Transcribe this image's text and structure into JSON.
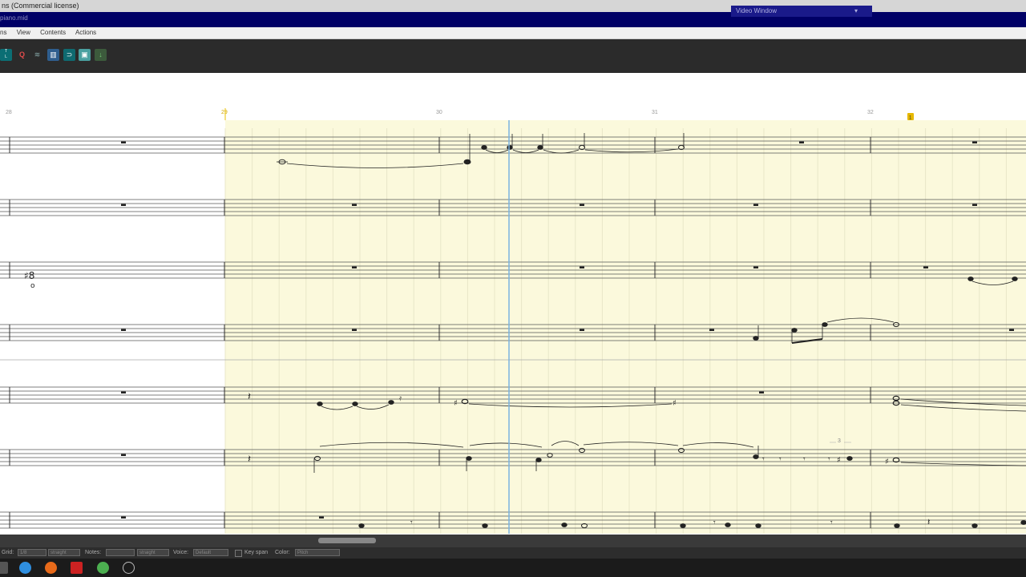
{
  "window": {
    "title": "ns (Commercial license)",
    "file": "piano.mid",
    "video_window": "Video Window"
  },
  "menu": {
    "items": [
      "ns",
      "View",
      "Contents",
      "Actions"
    ]
  },
  "toolbar": {
    "buttons": [
      "Track List",
      "Quantize",
      "Mixer",
      "Grid",
      "Loop",
      "Video",
      "Export"
    ]
  },
  "score": {
    "measures": [
      "28",
      "29",
      "30",
      "31",
      "32"
    ],
    "marker": "1",
    "triplet": "3"
  },
  "status": {
    "grid_label": "Grid:",
    "grid_value": "1/8",
    "grid_mode": "straight",
    "notes_label": "Notes:",
    "notes_value": "",
    "notes_mode": "straight",
    "voice_label": "Voice:",
    "voice_value": "Default",
    "keyspan_label": "Key span",
    "color_label": "Color:",
    "color_value": "Pitch"
  },
  "colors": {
    "highlight": "#fbf9dc",
    "playhead": "#7ab3e0",
    "title_bg": "#000066"
  }
}
